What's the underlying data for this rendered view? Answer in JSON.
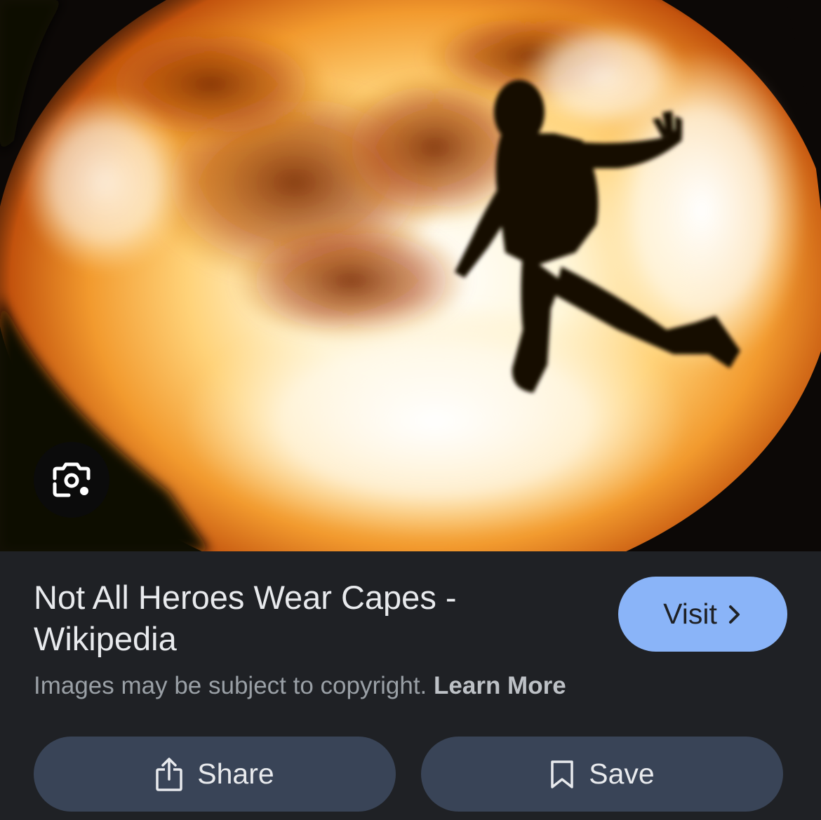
{
  "image": {
    "alt_icon": "explosion-silhouette-image"
  },
  "lens": {
    "icon": "lens-camera-icon"
  },
  "result": {
    "title": "Not All Heroes Wear Capes - Wikipedia",
    "copyright_text": "Images may be subject to copyright.",
    "learn_more": "Learn More"
  },
  "visit": {
    "label": "Visit",
    "icon": "chevron-right-icon"
  },
  "actions": {
    "share_label": "Share",
    "share_icon": "share-icon",
    "save_label": "Save",
    "save_icon": "bookmark-icon"
  },
  "colors": {
    "panel_bg": "#1f2125",
    "visit_bg": "#8ab4f8",
    "action_bg": "#394457",
    "text_primary": "#e8eaed",
    "text_secondary": "#9aa0a6"
  }
}
